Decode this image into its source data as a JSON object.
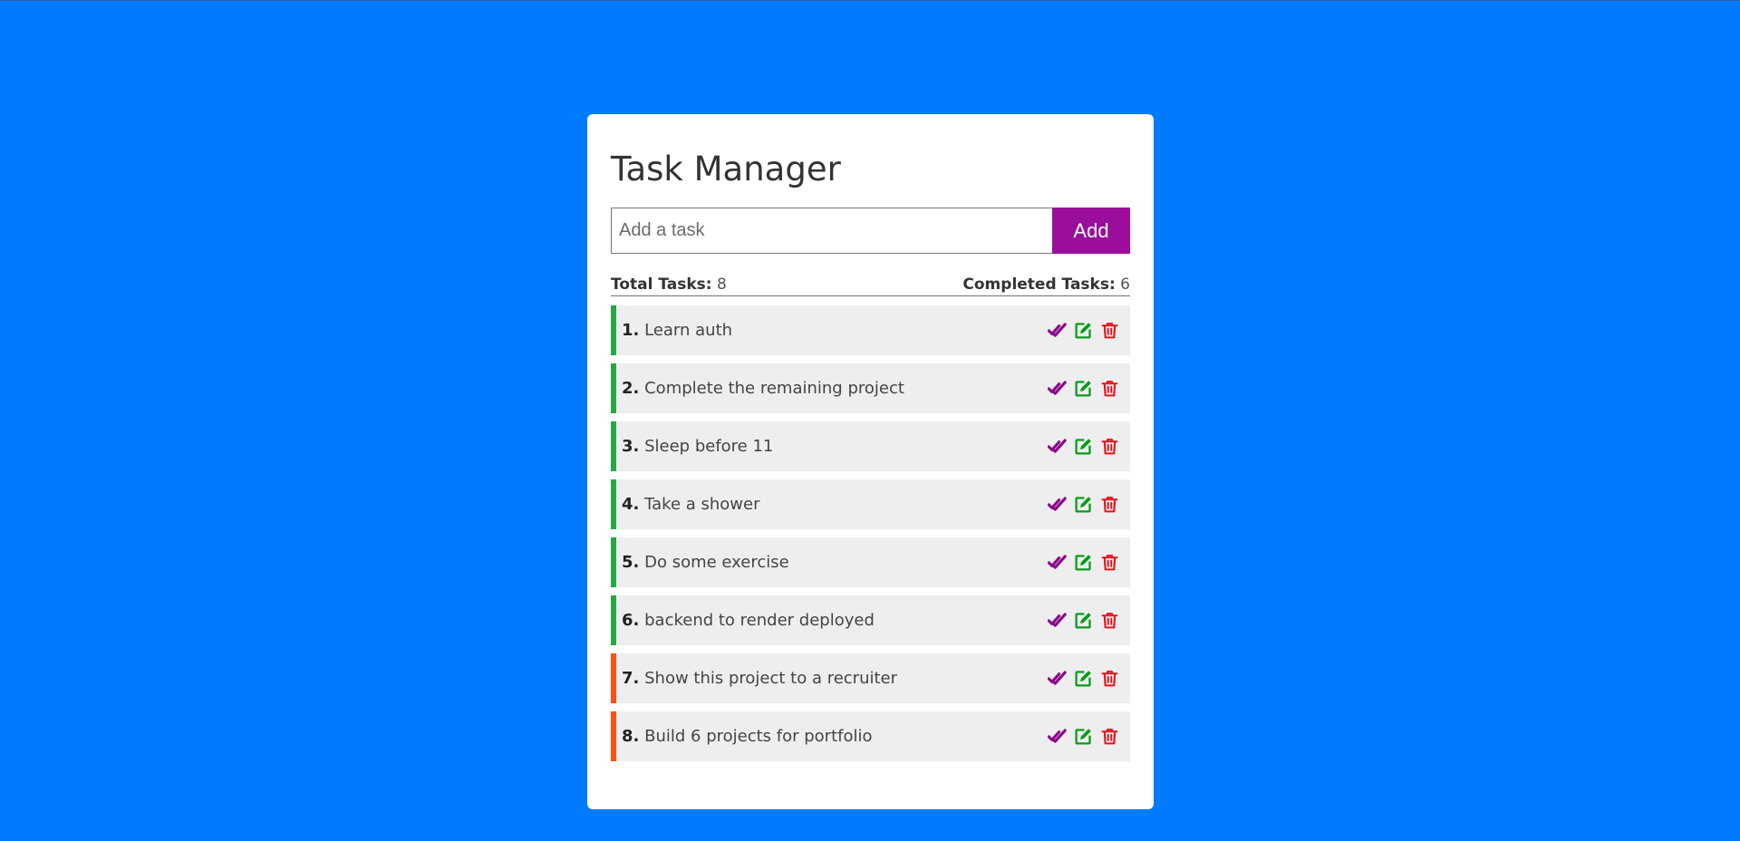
{
  "app": {
    "title": "Task Manager",
    "background_color": "#007bff"
  },
  "form": {
    "placeholder": "Add a task",
    "value": "",
    "add_label": "Add",
    "add_color": "#9b0e9b"
  },
  "stats": {
    "total_label": "Total Tasks:",
    "total_value": "8",
    "completed_label": "Completed Tasks:",
    "completed_value": "6"
  },
  "status_colors": {
    "completed": "#28a745",
    "pending": "#fd5014"
  },
  "icons": {
    "complete": "double-check-icon",
    "edit": "edit-icon",
    "delete": "trash-icon"
  },
  "tasks": [
    {
      "num": "1.",
      "text": "Learn auth",
      "status": "completed"
    },
    {
      "num": "2.",
      "text": "Complete the remaining project",
      "status": "completed"
    },
    {
      "num": "3.",
      "text": "Sleep before 11",
      "status": "completed"
    },
    {
      "num": "4.",
      "text": "Take a shower",
      "status": "completed"
    },
    {
      "num": "5.",
      "text": "Do some exercise",
      "status": "completed"
    },
    {
      "num": "6.",
      "text": "backend to render deployed",
      "status": "completed"
    },
    {
      "num": "7.",
      "text": "Show this project to a recruiter",
      "status": "pending"
    },
    {
      "num": "8.",
      "text": "Build 6 projects for portfolio",
      "status": "pending"
    }
  ]
}
